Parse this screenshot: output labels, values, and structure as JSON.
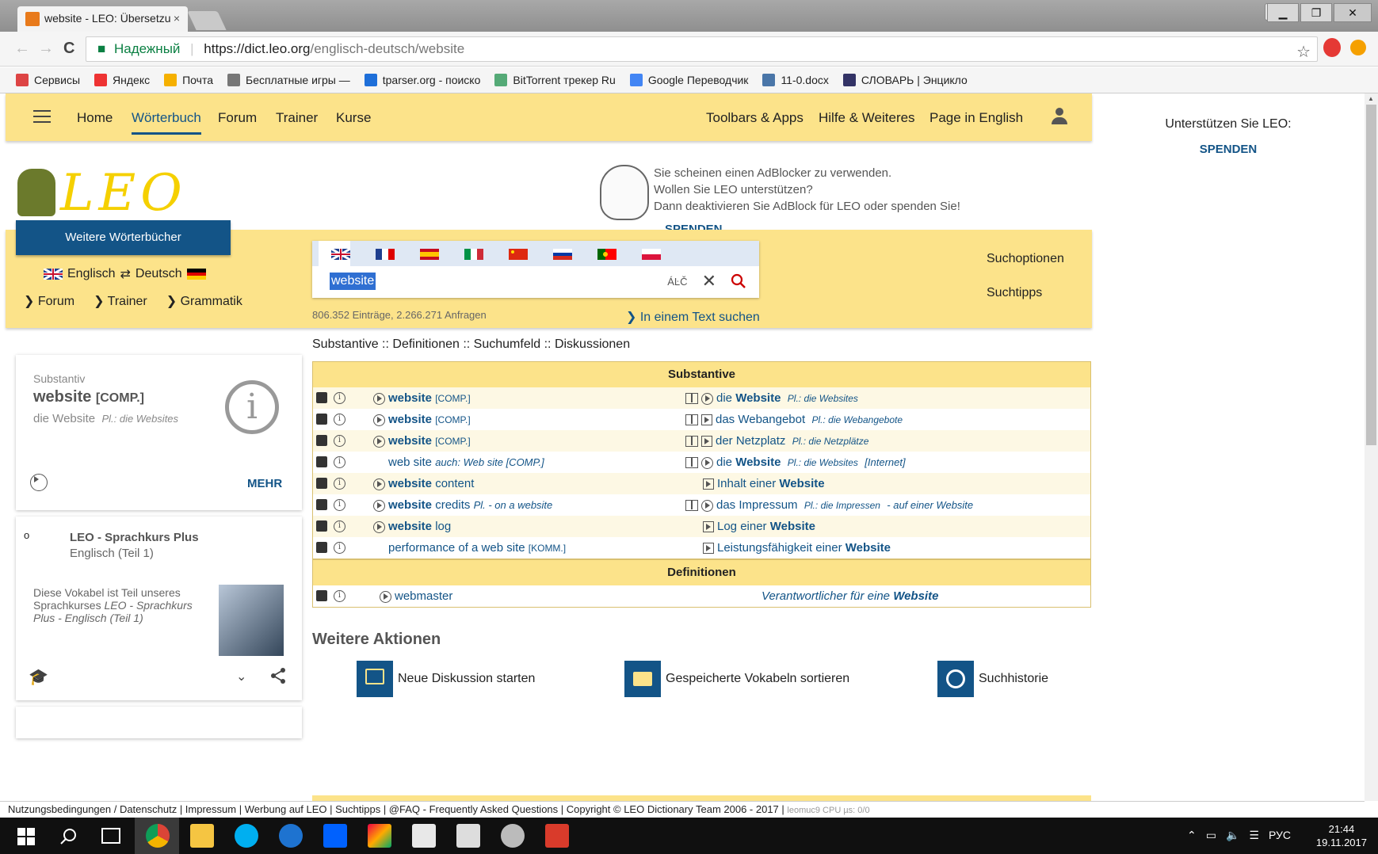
{
  "browser": {
    "tab_title": "website - LEO: Übersetzu",
    "tab_close": "×",
    "win_min": "▁",
    "win_max": "❐",
    "win_close": "✕",
    "user_icon": "⍝",
    "back": "←",
    "forward": "→",
    "reload": "C",
    "lock": "🔒",
    "secure_label": "Надежный",
    "url_host": "https://dict.leo.org",
    "url_path": "/englisch-deutsch/website",
    "star": "☆",
    "bookmarks": [
      {
        "label": "Сервисы",
        "color": "#d44"
      },
      {
        "label": "Яндекс",
        "color": "#e33"
      },
      {
        "label": "Почта",
        "color": "#f5b000"
      },
      {
        "label": "Бесплатные игры —",
        "color": "#777"
      },
      {
        "label": "tparser.org - поиско",
        "color": "#1e6fd9"
      },
      {
        "label": "BitTorrent трекер Ru",
        "color": "#5a7"
      },
      {
        "label": "Google Переводчик",
        "color": "#4285f4"
      },
      {
        "label": "11-0.docx",
        "color": "#4a76a8"
      },
      {
        "label": "СЛОВАРЬ | Энцикло",
        "color": "#336"
      }
    ]
  },
  "nav": {
    "items": [
      "Home",
      "Wörterbuch",
      "Forum",
      "Trainer",
      "Kurse"
    ],
    "right_items": [
      "Toolbars & Apps",
      "Hilfe & Weiteres",
      "Page in English"
    ]
  },
  "logo_text": "LEO",
  "adblock": {
    "line1": "Sie scheinen einen AdBlocker zu verwenden.",
    "line2": "Wollen Sie LEO unterstützen?",
    "line3": "Dann deaktivieren Sie AdBlock für LEO oder spenden Sie!",
    "spenden": "SPENDEN"
  },
  "right_column": {
    "support": "Unterstützen Sie LEO:",
    "spenden": "SPENDEN"
  },
  "search": {
    "weitere": "Weitere Wörterbücher",
    "lang_from": "Englisch",
    "swap": "⇄",
    "lang_to": "Deutsch",
    "sublinks": [
      "Forum",
      "Trainer",
      "Grammatik"
    ],
    "query": "website",
    "special_chars": "ÁĿČ",
    "counts": "806.352 Einträge, 2.266.271 Anfragen",
    "in_text": "In einem Text suchen",
    "options": "Suchoptionen",
    "tips": "Suchtipps"
  },
  "result_nav": "Substantive :: Definitionen :: Suchumfeld :: Diskussionen",
  "side_card": {
    "pos": "Substantiv",
    "word": "website",
    "tag": "[COMP.]",
    "translation": "die Website",
    "plural": "Pl.: die Websites",
    "more": "MEHR"
  },
  "course_card": {
    "bullet": "o",
    "title": "LEO - Sprachkurs Plus",
    "subtitle": "Englisch (Teil 1)",
    "desc_a": "Diese Vokabel ist Teil unseres Sprachkurses ",
    "desc_b": "LEO - Sprachkurs Plus - Englisch (Teil 1)"
  },
  "substantive": {
    "header": "Substantive",
    "rows": [
      {
        "l_main": "website",
        "l_rest": "",
        "l_tag": "[COMP.]",
        "l_note": "",
        "r_pre": "die ",
        "r_main": "Website",
        "r_post": "",
        "r_pl": "Pl.: die Websites",
        "r_note": ""
      },
      {
        "l_main": "website",
        "l_rest": "",
        "l_tag": "[COMP.]",
        "l_note": "",
        "r_pre": "das Webangebot",
        "r_main": "",
        "r_post": "",
        "r_pl": "Pl.: die Webangebote",
        "r_note": ""
      },
      {
        "l_main": "website",
        "l_rest": "",
        "l_tag": "[COMP.]",
        "l_note": "",
        "r_pre": "der Netzplatz",
        "r_main": "",
        "r_post": "",
        "r_pl": "Pl.: die Netzplätze",
        "r_note": ""
      },
      {
        "l_main": "",
        "l_rest": "web site",
        "l_tag": "",
        "l_note": "auch: Web site [COMP.]",
        "r_pre": "die ",
        "r_main": "Website",
        "r_post": "",
        "r_pl": "Pl.: die Websites",
        "r_note": "[Internet]"
      },
      {
        "l_main": "website",
        "l_rest": " content",
        "l_tag": "",
        "l_note": "",
        "r_pre": "Inhalt einer ",
        "r_main": "Website",
        "r_post": "",
        "r_pl": "",
        "r_note": ""
      },
      {
        "l_main": "website",
        "l_rest": " credits",
        "l_tag": "",
        "l_note": "Pl.  - on a website",
        "r_pre": "das Impressum",
        "r_main": "",
        "r_post": "",
        "r_pl": "Pl.: die Impressen",
        "r_note": "- auf einer Website"
      },
      {
        "l_main": "website",
        "l_rest": " log",
        "l_tag": "",
        "l_note": "",
        "r_pre": "Log einer ",
        "r_main": "Website",
        "r_post": "",
        "r_pl": "",
        "r_note": ""
      },
      {
        "l_main": "",
        "l_rest": "performance of a web site",
        "l_tag": "[KOMM.]",
        "l_note": "",
        "r_pre": "Leistungsfähigkeit einer ",
        "r_main": "Website",
        "r_post": "",
        "r_pl": "",
        "r_note": ""
      }
    ]
  },
  "definitionen": {
    "header": "Definitionen",
    "left": "webmaster",
    "right_pre": "Verantwortlicher für eine ",
    "right_main": "Website"
  },
  "aktionen": {
    "title": "Weitere Aktionen",
    "items": [
      "Neue Diskussion starten",
      "Gespeicherte Vokabeln sortieren",
      "Suchhistorie"
    ]
  },
  "footer": {
    "text": "Nutzungsbedingungen / Datenschutz | Impressum | Werbung auf LEO | Suchtipps | @FAQ - Frequently Asked Questions | Copyright © LEO Dictionary Team 2006 - 2017 |",
    "small": "leomuc9  CPU µs: 0/0"
  },
  "taskbar": {
    "lang": "РУС",
    "time": "21:44",
    "date": "19.11.2017"
  },
  "colors": {
    "leo_yellow": "#fce38a",
    "leo_blue": "#135487"
  }
}
